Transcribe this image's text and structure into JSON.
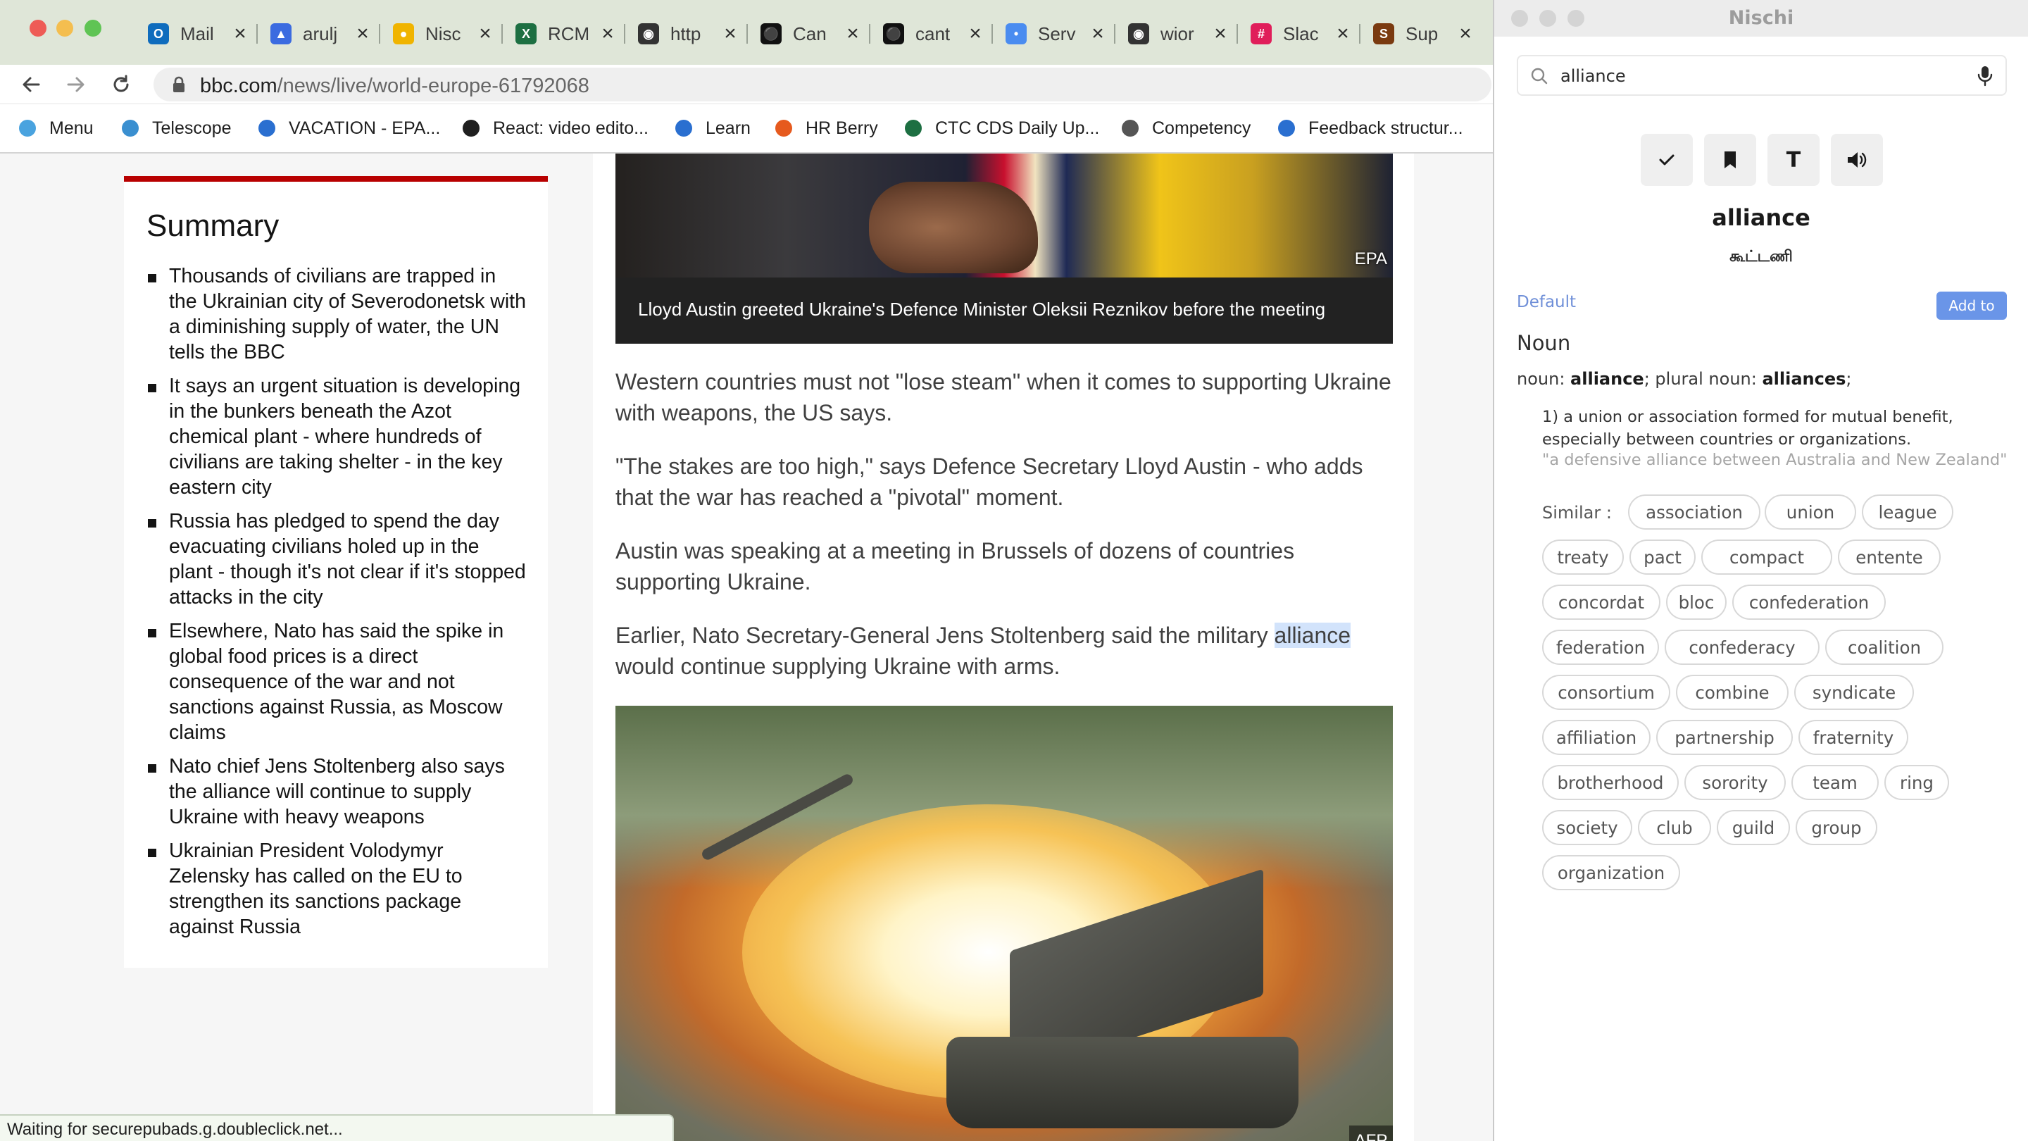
{
  "browser": {
    "tabs": [
      {
        "title": "Mail",
        "icon": "outlook-icon",
        "color": "#0f6cbd"
      },
      {
        "title": "arulj",
        "icon": "shield-icon",
        "color": "#3b6be0"
      },
      {
        "title": "Nisc",
        "icon": "nischi-icon",
        "color": "#f0b400"
      },
      {
        "title": "RCM",
        "icon": "excel-icon",
        "color": "#1d6f42"
      },
      {
        "title": "http",
        "icon": "globe-icon",
        "color": "#333333"
      },
      {
        "title": "Can",
        "icon": "github-icon",
        "color": "#111111"
      },
      {
        "title": "cant",
        "icon": "github-icon",
        "color": "#111111"
      },
      {
        "title": "Serv",
        "icon": "service-icon",
        "color": "#4a8cf0"
      },
      {
        "title": "wior",
        "icon": "globe-icon",
        "color": "#333333"
      },
      {
        "title": "Slac",
        "icon": "slack-icon",
        "color": "#e01e5a"
      },
      {
        "title": "Sup",
        "icon": "support-icon",
        "color": "#7a3a10"
      }
    ],
    "url": {
      "host": "bbc.com",
      "path": "/news/live/world-europe-61792068"
    },
    "bookmarks": [
      {
        "label": "Menu",
        "icon": "send-icon"
      },
      {
        "label": "Telescope",
        "icon": "telescope-icon"
      },
      {
        "label": "VACATION - EPA...",
        "icon": "sun-icon"
      },
      {
        "label": "React: video edito...",
        "icon": "globe-icon"
      },
      {
        "label": "Learn",
        "icon": "book-icon"
      },
      {
        "label": "HR Berry",
        "icon": "berry-icon"
      },
      {
        "label": "CTC CDS Daily Up...",
        "icon": "excel-icon"
      },
      {
        "label": "Competency",
        "icon": "cube-icon"
      },
      {
        "label": "Feedback structur...",
        "icon": "feedback-icon"
      }
    ],
    "status": "Waiting for securepubads.g.doubleclick.net..."
  },
  "summary": {
    "title": "Summary",
    "items": [
      "Thousands of civilians are trapped in the Ukrainian city of Severodonetsk with a diminishing supply of water, the UN tells the BBC",
      "It says an urgent situation is developing in the bunkers beneath the Azot chemical plant - where hundreds of civilians are taking shelter - in the key eastern city",
      "Russia has pledged to spend the day evacuating civilians holed up in the plant - though it's not clear if it's stopped attacks in the city",
      "Elsewhere, Nato has said the spike in global food prices is a direct consequence of the war and not sanctions against Russia, as Moscow claims",
      "Nato chief Jens Stoltenberg also says the alliance will continue to supply Ukraine with heavy weapons",
      "Ukrainian President Volodymyr Zelensky has called on the EU to strengthen its sanctions package against Russia"
    ]
  },
  "article": {
    "hero_credit": "EPA",
    "hero_caption": "Lloyd Austin greeted Ukraine's Defence Minister Oleksii Reznikov before the meeting",
    "p1": "Western countries must not \"lose steam\" when it comes to supporting Ukraine with weapons, the US says.",
    "p2": "\"The stakes are too high,\" says Defence Secretary Lloyd Austin - who adds that the war has reached a \"pivotal\" moment.",
    "p3": "Austin was speaking at a meeting in Brussels of dozens of countries supporting Ukraine.",
    "p4_before": "Earlier, Nato Secretary-General Jens Stoltenberg said the military ",
    "p4_highlight": "alliance",
    "p4_after": " would continue supplying Ukraine with arms.",
    "photo_credit": "AFP"
  },
  "nischi": {
    "app_title": "Nischi",
    "search_value": "alliance",
    "word": "alliance",
    "transliteration": "கூட்டணி",
    "dictionary": "Default",
    "add_to": "Add to",
    "part_of_speech": "Noun",
    "forms_prefix": "noun:",
    "noun_form": "alliance",
    "plural_prefix": "; plural noun:",
    "plural_form": "alliances",
    "plural_suffix": ";",
    "definition": "1)  a union or association formed for mutual benefit, especially between countries or organizations.",
    "example": "\"a defensive alliance between Australia and New Zealand\"",
    "similar_label": "Similar :",
    "similar": [
      "association",
      "union",
      "league",
      "treaty",
      "pact",
      "compact",
      "entente",
      "concordat",
      "bloc",
      "confederation",
      "federation",
      "confederacy",
      "coalition",
      "consortium",
      "combine",
      "syndicate",
      "affiliation",
      "partnership",
      "fraternity",
      "brotherhood",
      "sorority",
      "team",
      "ring",
      "society",
      "club",
      "guild",
      "group",
      "organization"
    ]
  }
}
